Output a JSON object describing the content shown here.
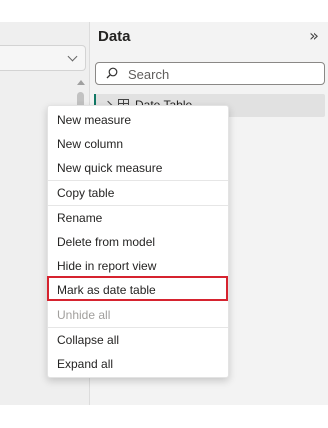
{
  "data_pane": {
    "title": "Data",
    "collapse_icon": "double-chevron-right-icon",
    "collapse_glyph": "»",
    "search": {
      "placeholder": "Search"
    },
    "table_row": {
      "label": "Date Table"
    }
  },
  "context_menu": {
    "items": [
      {
        "label": "New measure",
        "disabled": false
      },
      {
        "label": "New column",
        "disabled": false
      },
      {
        "label": "New quick measure",
        "disabled": false
      },
      {
        "label": "Copy table",
        "disabled": false
      },
      {
        "label": "Rename",
        "disabled": false
      },
      {
        "label": "Delete from model",
        "disabled": false
      },
      {
        "label": "Hide in report view",
        "disabled": false
      },
      {
        "label": "Mark as date table",
        "disabled": false,
        "highlighted": true
      },
      {
        "label": "Unhide all",
        "disabled": true
      },
      {
        "label": "Collapse all",
        "disabled": false
      },
      {
        "label": "Expand all",
        "disabled": false
      }
    ]
  },
  "colors": {
    "highlight_border": "#d6232f",
    "table_accent": "#117865"
  }
}
